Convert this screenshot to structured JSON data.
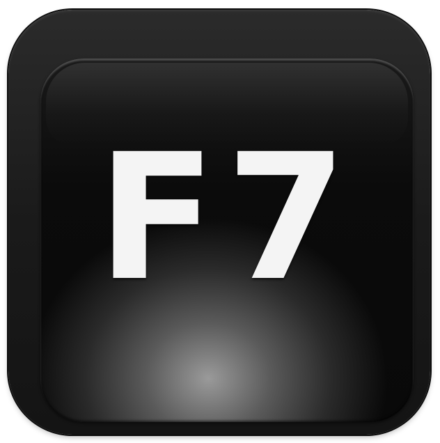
{
  "key": {
    "label": "F7"
  },
  "colors": {
    "housing": "#1a1a1a",
    "cap": "#0b0b0b",
    "glow": "#9a9a9a",
    "label": "#f4f4f4",
    "background": "#ffffff"
  }
}
